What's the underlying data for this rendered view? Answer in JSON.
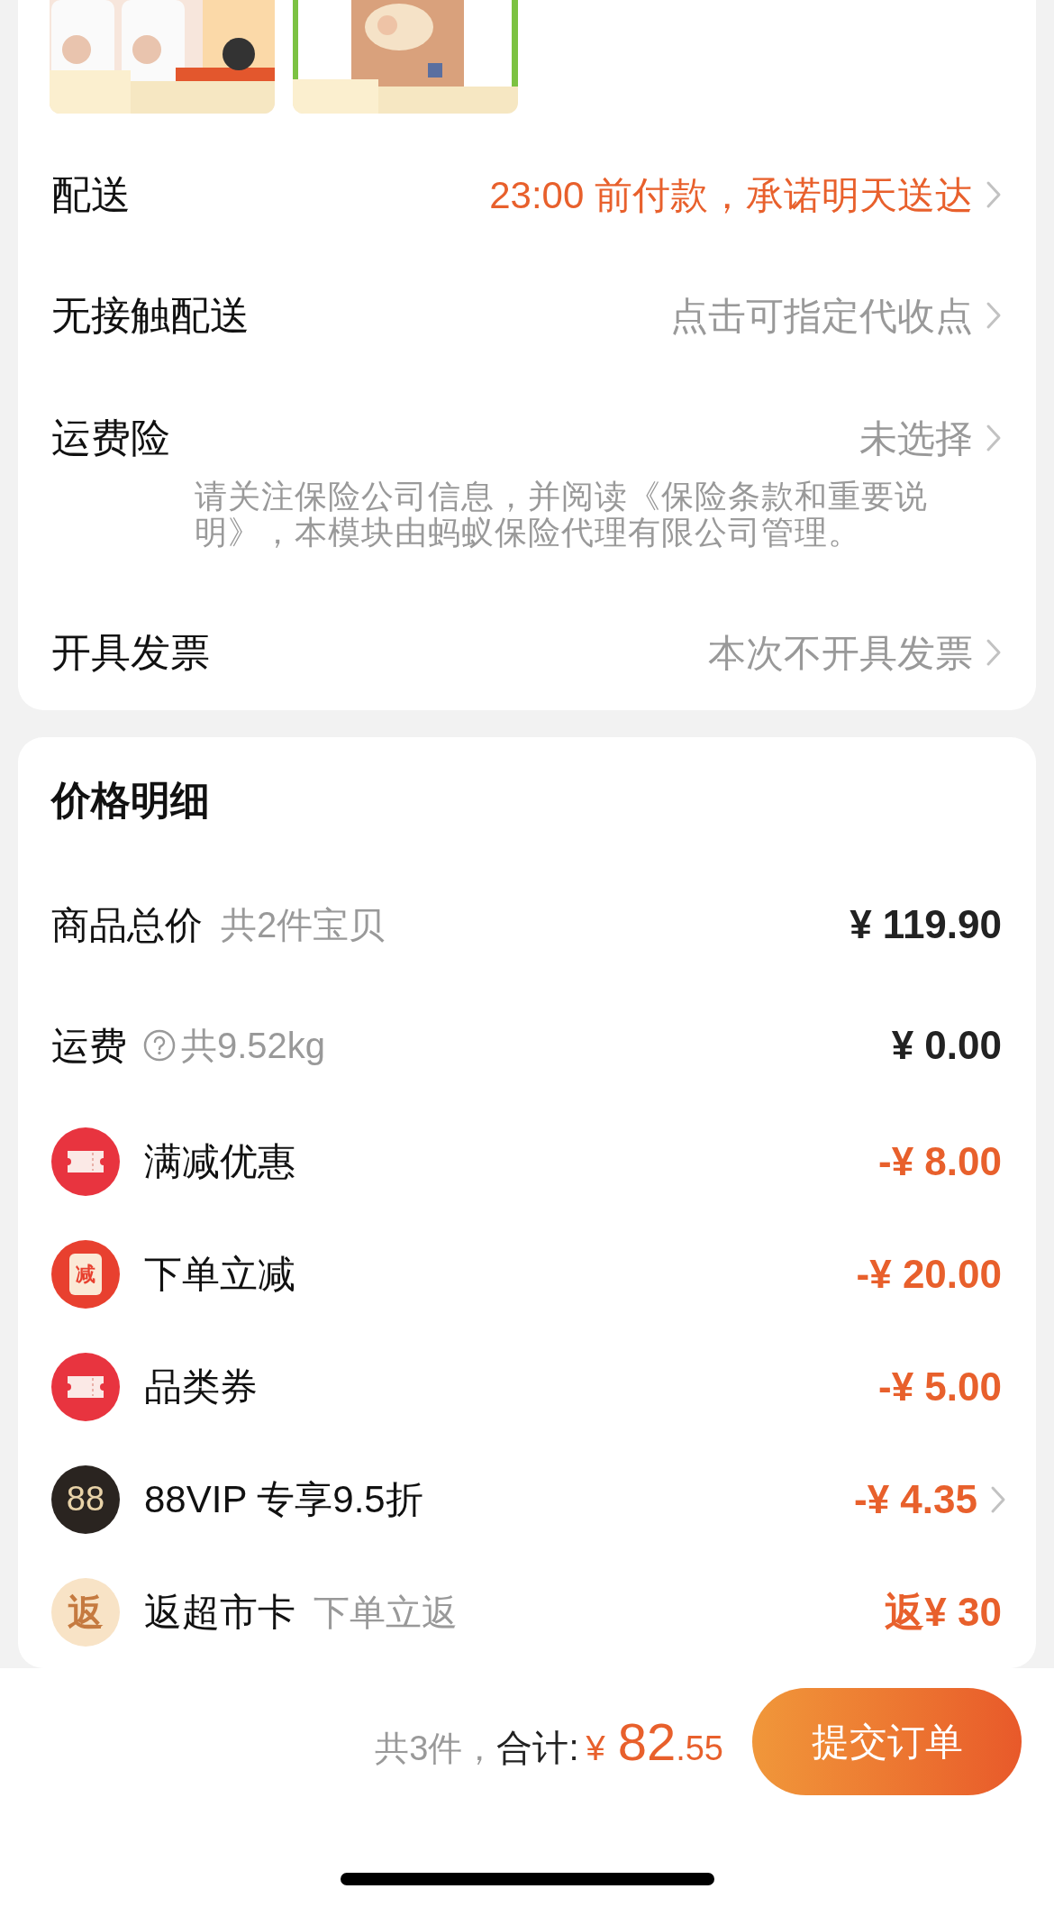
{
  "order_options": [
    {
      "label": "配送",
      "value": "23:00 前付款，承诺明天送达",
      "highlight": true
    },
    {
      "label": "无接触配送",
      "value": "点击可指定代收点",
      "highlight": false
    },
    {
      "label": "运费险",
      "value": "未选择",
      "highlight": false,
      "note": "请关注保险公司信息，并阅读《保险条款和重要说明》，本模块由蚂蚁保险代理有限公司管理。"
    },
    {
      "label": "开具发票",
      "value": "本次不开具发票",
      "highlight": false
    }
  ],
  "price_detail": {
    "title": "价格明细",
    "rows": [
      {
        "kind": "total",
        "label": "商品总价",
        "sub": "共2件宝贝",
        "amount": "¥ 119.90",
        "discount": false,
        "has_arrow": false
      },
      {
        "kind": "shipping",
        "label": "运费",
        "sub": "共9.52kg",
        "amount": "¥ 0.00",
        "discount": false,
        "has_arrow": false
      },
      {
        "kind": "coupon",
        "label": "满减优惠",
        "amount": "-¥ 8.00",
        "discount": true,
        "has_arrow": false
      },
      {
        "kind": "cut",
        "badge": "减",
        "label": "下单立减",
        "amount": "-¥ 20.00",
        "discount": true,
        "has_arrow": false
      },
      {
        "kind": "coupon",
        "label": "品类券",
        "amount": "-¥ 5.00",
        "discount": true,
        "has_arrow": false
      },
      {
        "kind": "vip",
        "badge": "88",
        "label": "88VIP 专享9.5折",
        "amount": "-¥ 4.35",
        "discount": true,
        "has_arrow": true
      },
      {
        "kind": "rebate",
        "badge": "返",
        "label": "返超市卡",
        "sub": "下单立返",
        "amount": "返¥ 30",
        "discount": true,
        "has_arrow": false
      }
    ]
  },
  "footer": {
    "count": "共3件，",
    "total_label": "合计:",
    "currency": "¥",
    "amount_int": "82",
    "amount_dec": ".55",
    "submit": "提交订单"
  }
}
